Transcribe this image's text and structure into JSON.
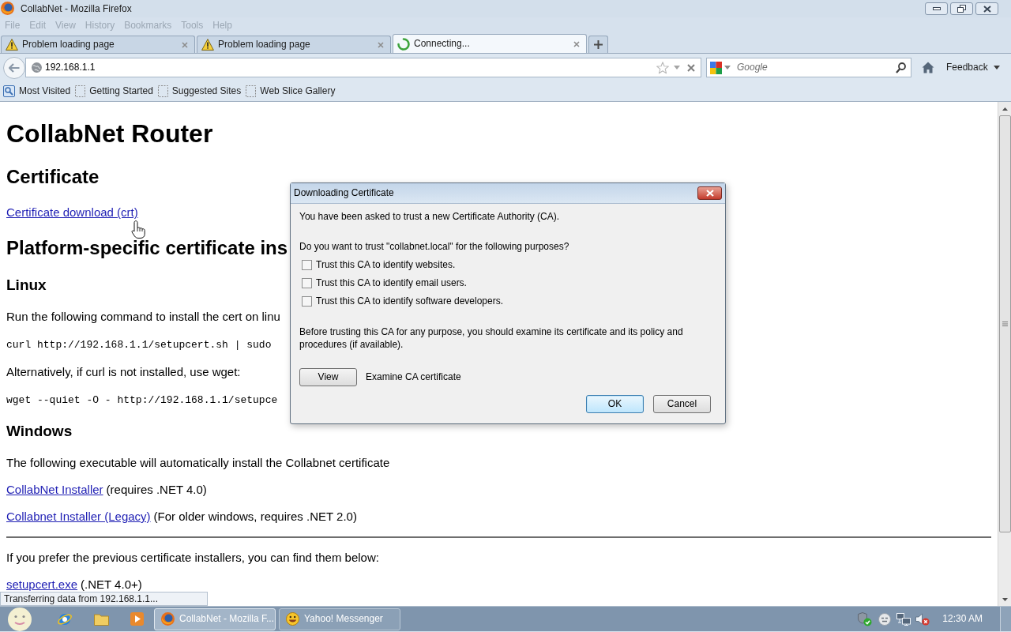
{
  "window": {
    "title": "CollabNet - Mozilla Firefox"
  },
  "menu_bar": [
    {
      "label": "File",
      "disabled": true
    },
    {
      "label": "Edit",
      "disabled": true
    },
    {
      "label": "View",
      "disabled": true
    },
    {
      "label": "History",
      "disabled": true
    },
    {
      "label": "Bookmarks",
      "disabled": true
    },
    {
      "label": "Tools",
      "disabled": true
    },
    {
      "label": "Help",
      "disabled": true
    }
  ],
  "tabs": [
    {
      "label": "Problem loading page",
      "kind": "warning",
      "selected": false
    },
    {
      "label": "Problem loading page",
      "kind": "warning",
      "selected": false
    },
    {
      "label": "Connecting...",
      "kind": "loading",
      "selected": true
    }
  ],
  "navigation": {
    "address": "192.168.1.1",
    "search_placeholder": "Google",
    "feedback": "Feedback"
  },
  "bookmarks": [
    {
      "label": "Most Visited",
      "kind": "folder"
    },
    {
      "label": "Getting Started",
      "kind": "page"
    },
    {
      "label": "Suggested Sites",
      "kind": "page"
    },
    {
      "label": "Web Slice Gallery",
      "kind": "page"
    }
  ],
  "page": {
    "blocks": [
      {
        "kind": "h1",
        "text": "CollabNet Router"
      },
      {
        "kind": "h2",
        "text": "Certificate"
      },
      {
        "kind": "link",
        "link": "Certificate download (crt)"
      },
      {
        "kind": "h2",
        "text": "Platform-specific certificate ins"
      },
      {
        "kind": "h3",
        "text": "Linux"
      },
      {
        "kind": "p",
        "text": "Run the following command to install the cert on linu"
      },
      {
        "kind": "code",
        "text": "curl http://192.168.1.1/setupcert.sh | sudo"
      },
      {
        "kind": "p",
        "text": "Alternatively, if curl is not installed, use wget:"
      },
      {
        "kind": "code",
        "text": "wget --quiet -O - http://192.168.1.1/setupce"
      },
      {
        "kind": "h3",
        "text": "Windows"
      },
      {
        "kind": "p",
        "text": "The following executable will automatically install the Collabnet certificate"
      },
      {
        "kind": "link",
        "link": "CollabNet Installer",
        "text": "(requires .NET 4.0)"
      },
      {
        "kind": "link",
        "link": "Collabnet Installer (Legacy)",
        "text": "(For older windows, requires .NET 2.0)"
      },
      {
        "kind": "rule"
      },
      {
        "kind": "p",
        "text": "If you prefer the previous certificate installers, you can find them below:"
      },
      {
        "kind": "link",
        "link": "setupcert.exe",
        "text": "(.NET 4.0+)"
      }
    ]
  },
  "status": "Transferring data from 192.168.1.1...",
  "dialog": {
    "title": "Downloading Certificate",
    "intro": "You have been asked to trust a new Certificate Authority (CA).",
    "question": "Do you want to trust \"collabnet.local\" for the following purposes?",
    "options": [
      {
        "label": "Trust this CA to identify websites.",
        "checked": false
      },
      {
        "label": "Trust this CA to identify email users.",
        "checked": false
      },
      {
        "label": "Trust this CA to identify software developers.",
        "checked": false
      }
    ],
    "note": "Before trusting this CA for any purpose, you should examine its certificate and its policy and procedures (if available).",
    "view_button": "View",
    "view_caption": "Examine CA certificate",
    "buttons": [
      {
        "label": "OK",
        "default": true
      },
      {
        "label": "Cancel",
        "default": false
      }
    ]
  },
  "taskbar": {
    "tasks": [
      {
        "label": "CollabNet - Mozilla F...",
        "kind": "browser",
        "selected": true
      },
      {
        "label": "Yahoo! Messenger",
        "kind": "messenger",
        "selected": false
      }
    ],
    "clock": "12:30 AM"
  }
}
